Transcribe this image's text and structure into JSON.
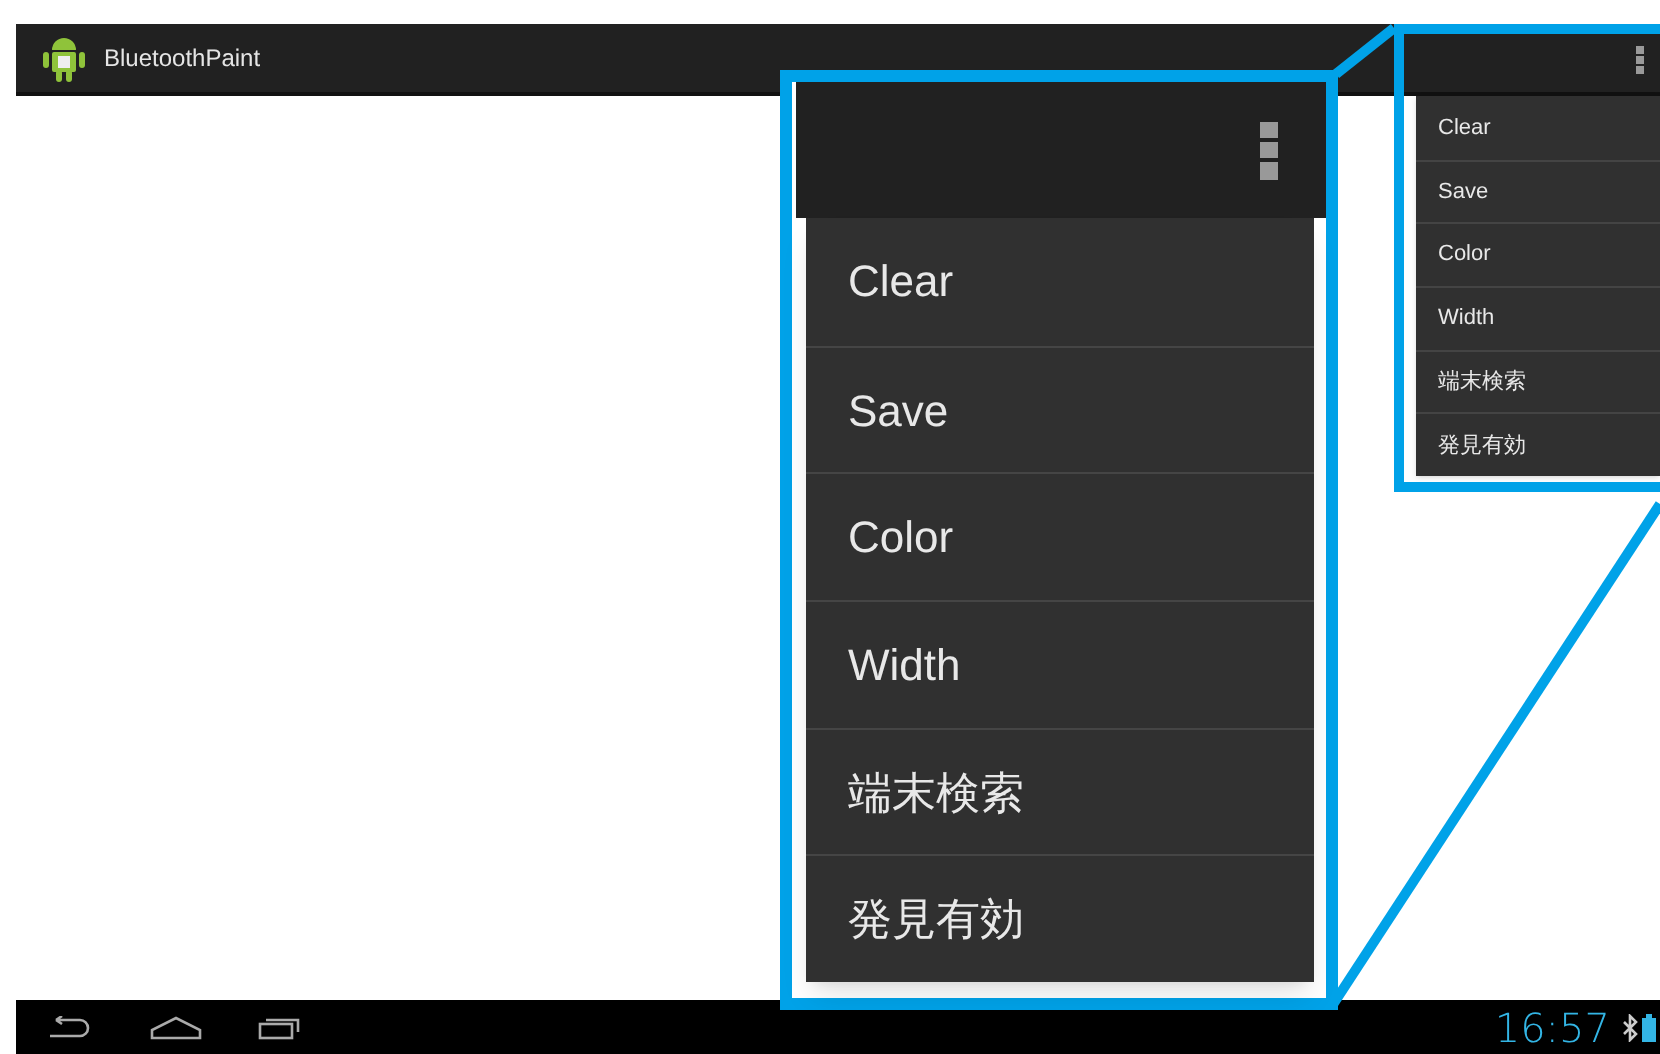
{
  "action_bar": {
    "title": "BluetoothPaint"
  },
  "overflow_menu": {
    "items": [
      {
        "label": "Clear"
      },
      {
        "label": "Save"
      },
      {
        "label": "Color"
      },
      {
        "label": "Width"
      },
      {
        "label": "端末検索"
      },
      {
        "label": "発見有効"
      }
    ]
  },
  "zoom_callout": {
    "items": [
      {
        "label": "Clear"
      },
      {
        "label": "Save"
      },
      {
        "label": "Color"
      },
      {
        "label": "Width"
      },
      {
        "label": "端末検索"
      },
      {
        "label": "発見有効"
      }
    ]
  },
  "system_bar": {
    "time": "16:57"
  }
}
